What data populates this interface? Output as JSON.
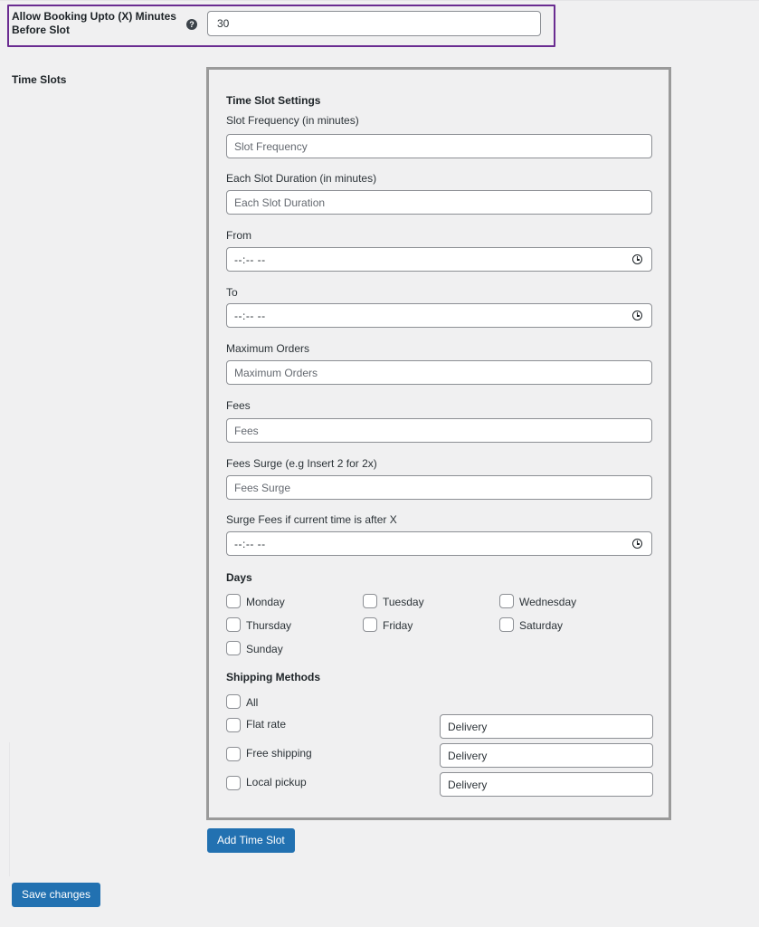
{
  "booking_setting": {
    "label": "Allow Booking Upto (X) Minutes Before Slot",
    "help_icon": "?",
    "value": "30"
  },
  "time_slots": {
    "section_label": "Time Slots",
    "panel_title": "Time Slot Settings",
    "slot_frequency": {
      "label": "Slot Frequency (in minutes)",
      "placeholder": "Slot Frequency"
    },
    "slot_duration": {
      "label": "Each Slot Duration (in minutes)",
      "placeholder": "Each Slot Duration"
    },
    "from": {
      "label": "From",
      "value": "--:-- --"
    },
    "to": {
      "label": "To",
      "value": "--:-- --"
    },
    "max_orders": {
      "label": "Maximum Orders",
      "placeholder": "Maximum Orders"
    },
    "fees": {
      "label": "Fees",
      "placeholder": "Fees"
    },
    "fees_surge": {
      "label": "Fees Surge (e.g Insert 2 for 2x)",
      "placeholder": "Fees Surge"
    },
    "surge_time": {
      "label": "Surge Fees if current time is after X",
      "value": "--:-- --"
    },
    "days_heading": "Days",
    "days": [
      "Monday",
      "Tuesday",
      "Wednesday",
      "Thursday",
      "Friday",
      "Saturday",
      "Sunday"
    ],
    "shipping_heading": "Shipping Methods",
    "shipping_all": "All",
    "shipping_methods": [
      {
        "label": "Flat rate",
        "value": "Delivery"
      },
      {
        "label": "Free shipping",
        "value": "Delivery"
      },
      {
        "label": "Local pickup",
        "value": "Delivery"
      }
    ]
  },
  "buttons": {
    "add_time_slot": "Add Time Slot",
    "save_changes": "Save changes"
  },
  "colors": {
    "primary_button": "#2271b1",
    "highlight_border": "#6a2c91",
    "background": "#f0f0f1"
  }
}
